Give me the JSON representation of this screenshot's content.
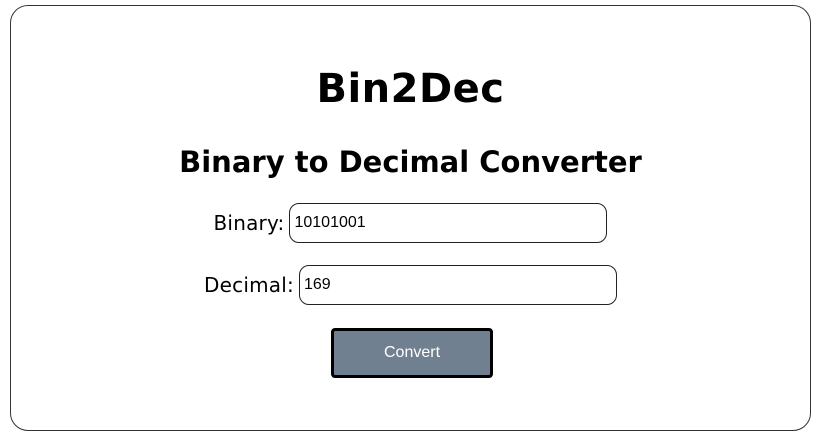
{
  "app": {
    "title": "Bin2Dec",
    "subtitle": "Binary to Decimal Converter"
  },
  "form": {
    "binary": {
      "label": "Binary:",
      "value": "10101001"
    },
    "decimal": {
      "label": "Decimal:",
      "value": "169"
    },
    "convert_label": "Convert"
  },
  "colors": {
    "button_background": "#708090",
    "button_text": "#ffffff",
    "border": "#000000"
  }
}
